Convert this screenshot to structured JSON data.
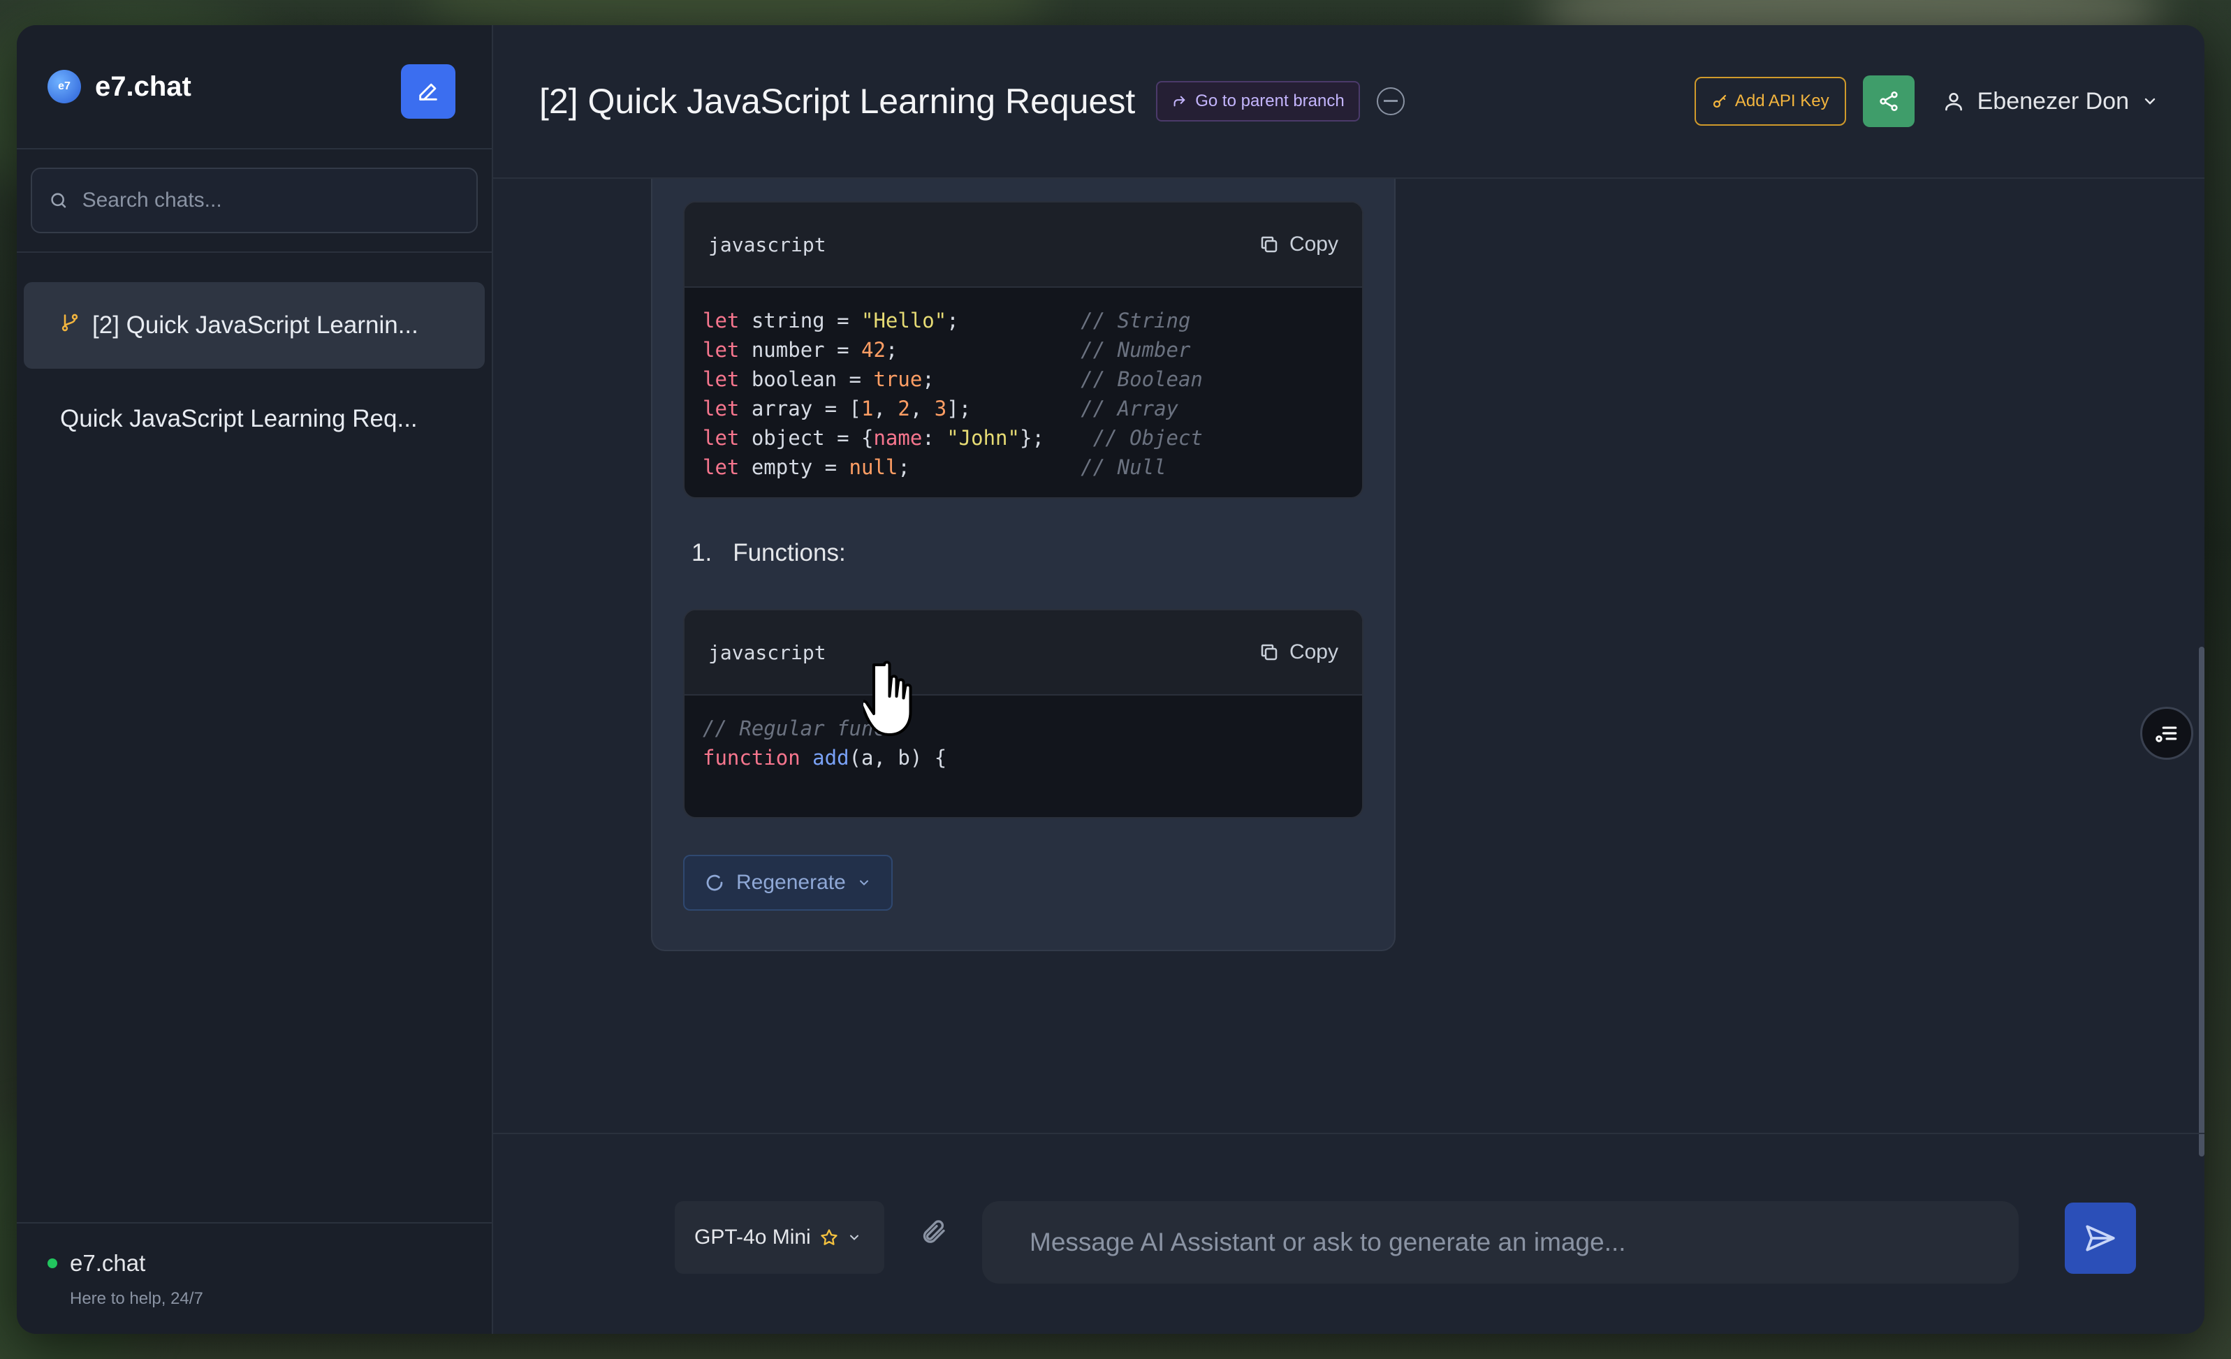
{
  "app": {
    "brand": "e7.chat",
    "logo_text": "e7"
  },
  "sidebar": {
    "search_placeholder": "Search chats...",
    "chats": [
      {
        "title": "[2] Quick JavaScript Learnin...",
        "active": true,
        "branched": true
      },
      {
        "title": "Quick JavaScript Learning Req...",
        "active": false,
        "branched": false
      }
    ],
    "footer": {
      "status_label": "e7.chat",
      "tagline": "Here to help, 24/7"
    }
  },
  "header": {
    "title": "[2] Quick JavaScript Learning Request",
    "parent_branch_label": "Go to parent branch",
    "api_key_label": "Add API Key",
    "user_name": "Ebenezer Don"
  },
  "message": {
    "code_block_1": {
      "lang": "javascript",
      "copy_label": "Copy"
    },
    "list_item": {
      "number": "1.",
      "text": "Functions:"
    },
    "code_block_2": {
      "lang": "javascript",
      "copy_label": "Copy"
    },
    "regenerate_label": "Regenerate"
  },
  "composer": {
    "model_label": "GPT-4o Mini",
    "placeholder": "Message AI Assistant or ask to generate an image..."
  },
  "colors": {
    "accent_blue": "#3b6ef0",
    "share_green": "#3f9d6a",
    "api_amber": "#d09a2b",
    "status_green": "#22c55e"
  }
}
